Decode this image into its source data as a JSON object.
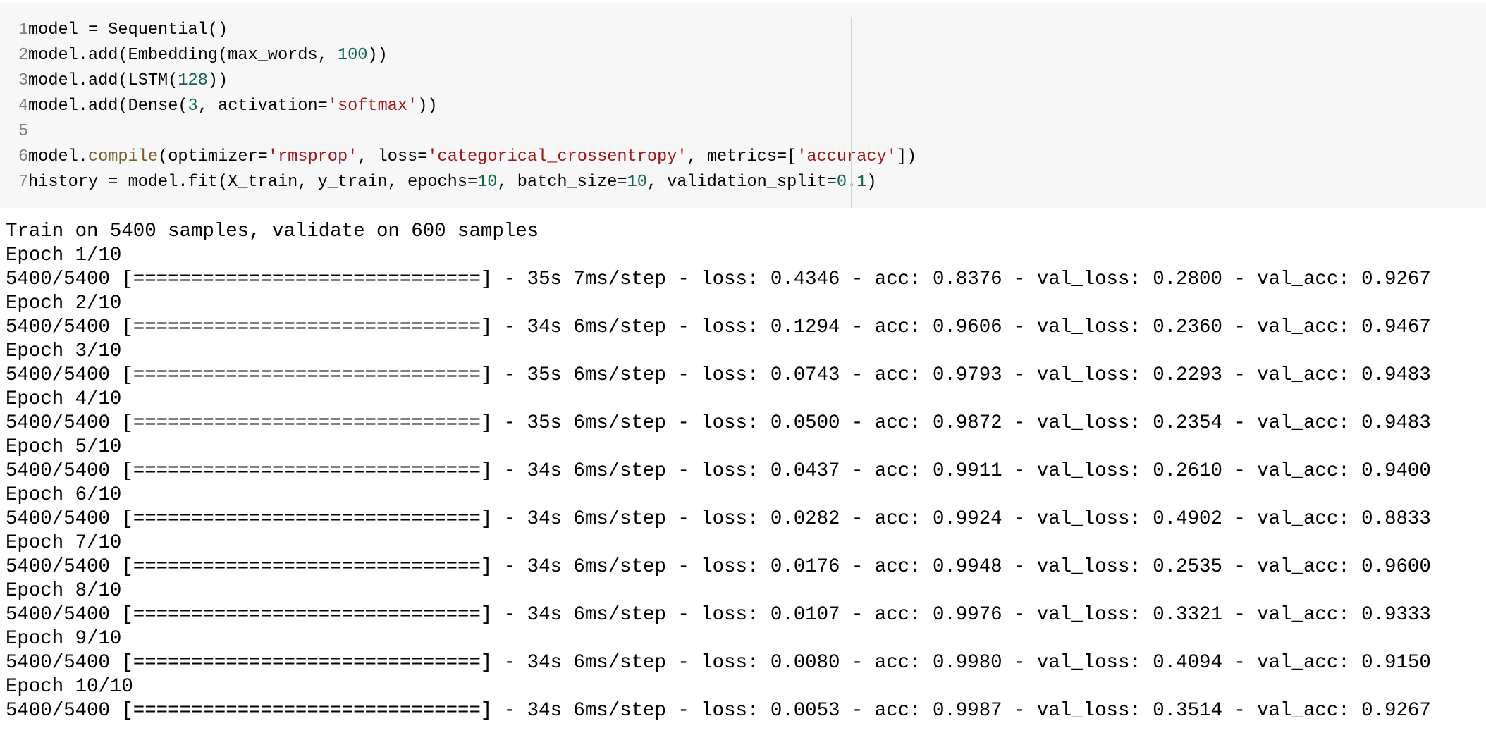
{
  "code_cell": {
    "lines": [
      {
        "number": "1",
        "tokens": [
          {
            "text": "model = Sequential()",
            "kind": "txt"
          }
        ]
      },
      {
        "number": "2",
        "tokens": [
          {
            "text": "model.add(Embedding(max_words, ",
            "kind": "txt"
          },
          {
            "text": "100",
            "kind": "num"
          },
          {
            "text": "))",
            "kind": "txt"
          }
        ]
      },
      {
        "number": "3",
        "tokens": [
          {
            "text": "model.add(LSTM(",
            "kind": "txt"
          },
          {
            "text": "128",
            "kind": "num"
          },
          {
            "text": "))",
            "kind": "txt"
          }
        ]
      },
      {
        "number": "4",
        "tokens": [
          {
            "text": "model.add(Dense(",
            "kind": "txt"
          },
          {
            "text": "3",
            "kind": "num"
          },
          {
            "text": ", activation=",
            "kind": "txt"
          },
          {
            "text": "'softmax'",
            "kind": "str"
          },
          {
            "text": "))",
            "kind": "txt"
          }
        ]
      },
      {
        "number": "5",
        "tokens": []
      },
      {
        "number": "6",
        "tokens": [
          {
            "text": "model.",
            "kind": "txt"
          },
          {
            "text": "compile",
            "kind": "kw"
          },
          {
            "text": "(optimizer=",
            "kind": "txt"
          },
          {
            "text": "'rmsprop'",
            "kind": "str"
          },
          {
            "text": ", loss=",
            "kind": "txt"
          },
          {
            "text": "'categorical_crossentropy'",
            "kind": "str"
          },
          {
            "text": ", metrics=[",
            "kind": "txt"
          },
          {
            "text": "'accuracy'",
            "kind": "str"
          },
          {
            "text": "])",
            "kind": "txt"
          }
        ]
      },
      {
        "number": "7",
        "tokens": [
          {
            "text": "history = model.fit(X_train, y_train, epochs=",
            "kind": "txt"
          },
          {
            "text": "10",
            "kind": "num"
          },
          {
            "text": ", batch_size=",
            "kind": "txt"
          },
          {
            "text": "10",
            "kind": "num"
          },
          {
            "text": ", validation_split=",
            "kind": "txt"
          },
          {
            "text": "0.1",
            "kind": "num"
          },
          {
            "text": ")",
            "kind": "txt"
          }
        ]
      }
    ]
  },
  "output": {
    "lines": [
      "Train on 5400 samples, validate on 600 samples",
      "Epoch 1/10",
      "5400/5400 [==============================] - 35s 7ms/step - loss: 0.4346 - acc: 0.8376 - val_loss: 0.2800 - val_acc: 0.9267",
      "Epoch 2/10",
      "5400/5400 [==============================] - 34s 6ms/step - loss: 0.1294 - acc: 0.9606 - val_loss: 0.2360 - val_acc: 0.9467",
      "Epoch 3/10",
      "5400/5400 [==============================] - 35s 6ms/step - loss: 0.0743 - acc: 0.9793 - val_loss: 0.2293 - val_acc: 0.9483",
      "Epoch 4/10",
      "5400/5400 [==============================] - 35s 6ms/step - loss: 0.0500 - acc: 0.9872 - val_loss: 0.2354 - val_acc: 0.9483",
      "Epoch 5/10",
      "5400/5400 [==============================] - 34s 6ms/step - loss: 0.0437 - acc: 0.9911 - val_loss: 0.2610 - val_acc: 0.9400",
      "Epoch 6/10",
      "5400/5400 [==============================] - 34s 6ms/step - loss: 0.0282 - acc: 0.9924 - val_loss: 0.4902 - val_acc: 0.8833",
      "Epoch 7/10",
      "5400/5400 [==============================] - 34s 6ms/step - loss: 0.0176 - acc: 0.9948 - val_loss: 0.2535 - val_acc: 0.9600",
      "Epoch 8/10",
      "5400/5400 [==============================] - 34s 6ms/step - loss: 0.0107 - acc: 0.9976 - val_loss: 0.3321 - val_acc: 0.9333",
      "Epoch 9/10",
      "5400/5400 [==============================] - 34s 6ms/step - loss: 0.0080 - acc: 0.9980 - val_loss: 0.4094 - val_acc: 0.9150",
      "Epoch 10/10",
      "5400/5400 [==============================] - 34s 6ms/step - loss: 0.0053 - acc: 0.9987 - val_loss: 0.3514 - val_acc: 0.9267"
    ]
  },
  "colors": {
    "cell_background": "#f7f7f7",
    "number_token": "#116644",
    "string_token": "#a31515",
    "builtin_token": "#795e26",
    "line_number": "#808080"
  }
}
